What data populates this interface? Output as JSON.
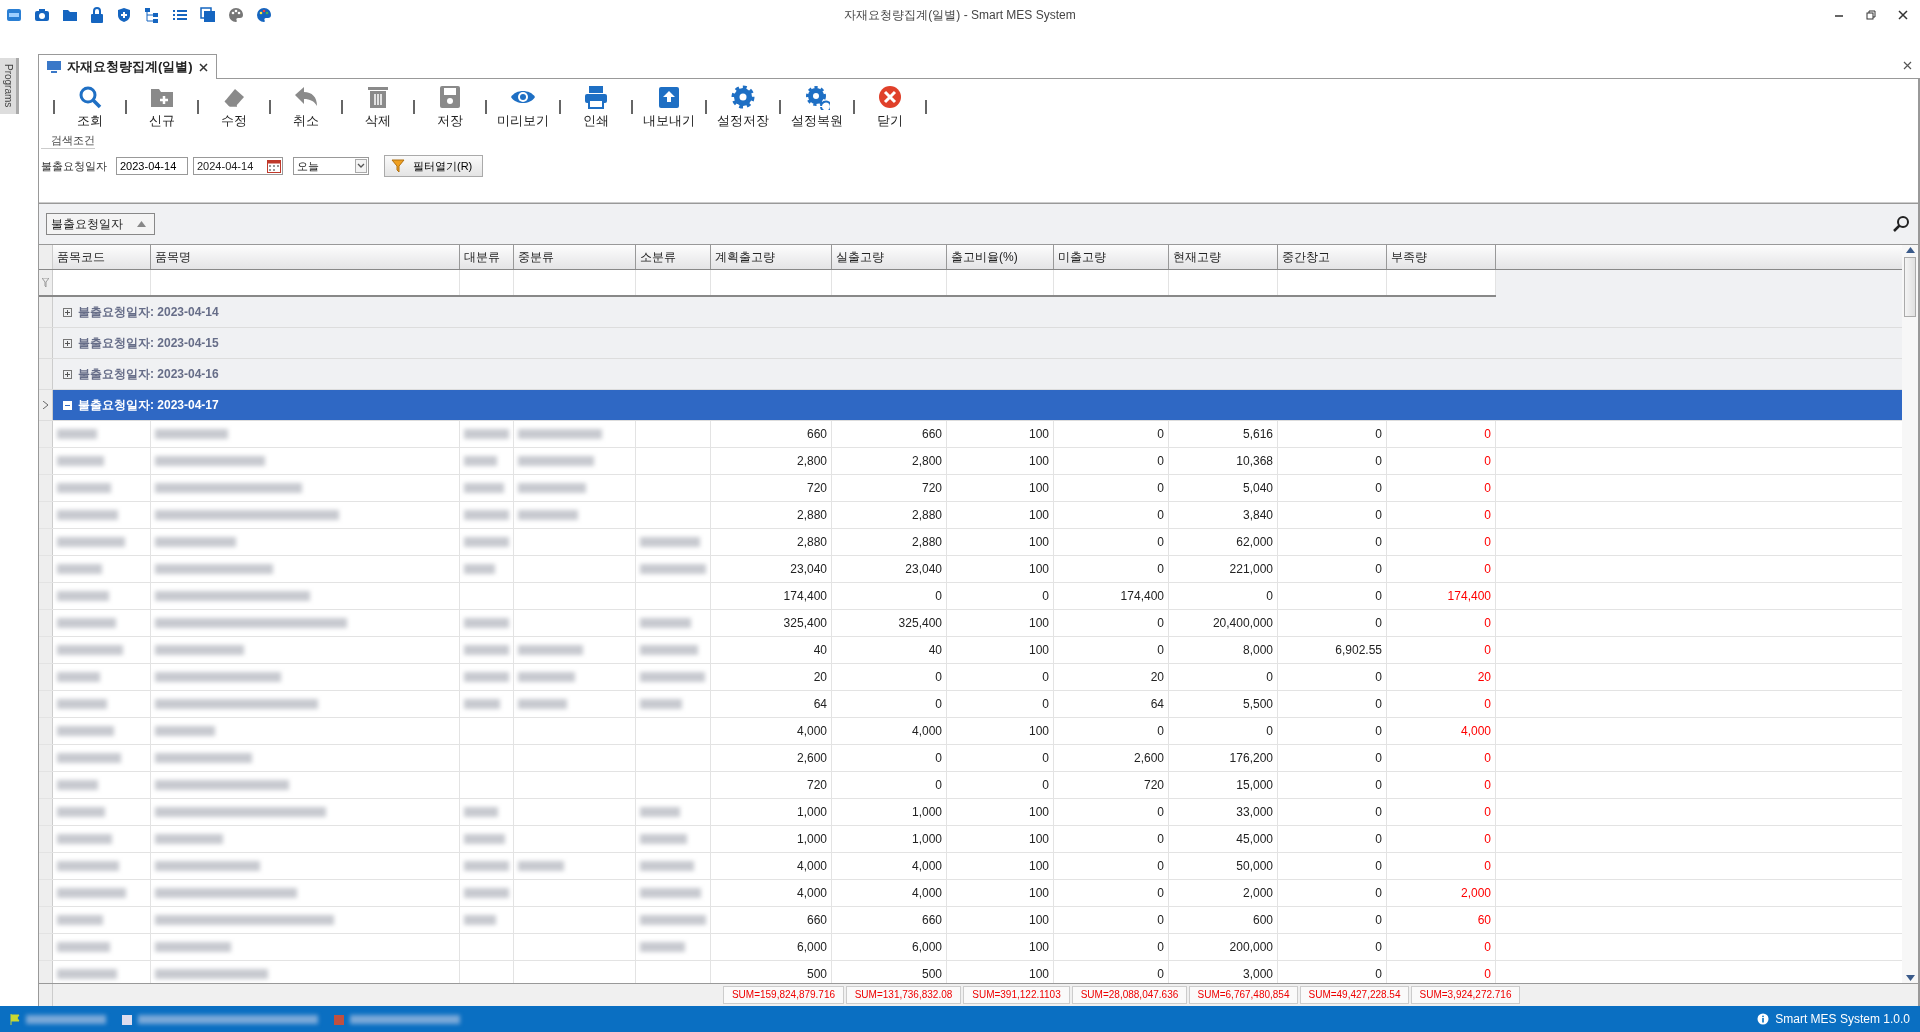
{
  "window": {
    "title": "자재요청량집계(일별) - Smart MES System"
  },
  "quick_icons": [
    {
      "kind": "app"
    },
    {
      "kind": "camera"
    },
    {
      "kind": "folder"
    },
    {
      "kind": "lock"
    },
    {
      "kind": "shield"
    },
    {
      "kind": "tree"
    },
    {
      "kind": "list"
    },
    {
      "kind": "windows"
    },
    {
      "kind": "palette"
    },
    {
      "kind": "palette-color"
    }
  ],
  "side_panel": {
    "label": "Programs"
  },
  "document_tab": {
    "label": "자재요청량집계(일별)",
    "selected": true
  },
  "toolbar": [
    {
      "label": "조회",
      "kind": "search"
    },
    {
      "label": "신규",
      "kind": "new"
    },
    {
      "label": "수정",
      "kind": "edit"
    },
    {
      "label": "취소",
      "kind": "undo"
    },
    {
      "label": "삭제",
      "kind": "delete"
    },
    {
      "label": "저장",
      "kind": "save"
    },
    {
      "label": "미리보기",
      "kind": "preview"
    },
    {
      "label": "인쇄",
      "kind": "print"
    },
    {
      "label": "내보내기",
      "kind": "export"
    },
    {
      "label": "설정저장",
      "kind": "settings-save"
    },
    {
      "label": "설정복원",
      "kind": "settings-restore"
    },
    {
      "label": "닫기",
      "kind": "close"
    }
  ],
  "search": {
    "group_title": "검색조건",
    "label": "불출요청일자",
    "date_from": "2023-04-14",
    "date_to": "2024-04-14",
    "period": "오늘",
    "filter_button": "필터열기(R)"
  },
  "grid": {
    "group_by": "불출요청일자",
    "columns": [
      {
        "label": "품목코드"
      },
      {
        "label": "품목명"
      },
      {
        "label": "대분류"
      },
      {
        "label": "중분류"
      },
      {
        "label": "소분류"
      },
      {
        "label": "계획출고량"
      },
      {
        "label": "실출고량"
      },
      {
        "label": "출고비율(%)"
      },
      {
        "label": "미출고량"
      },
      {
        "label": "현재고량"
      },
      {
        "label": "중간창고"
      },
      {
        "label": "부족량"
      }
    ],
    "groups": [
      {
        "label": "불출요청일자: 2023-04-14",
        "expanded": false,
        "selected": false
      },
      {
        "label": "불출요청일자: 2023-04-15",
        "expanded": false,
        "selected": false
      },
      {
        "label": "불출요청일자: 2023-04-16",
        "expanded": false,
        "selected": false
      },
      {
        "label": "불출요청일자: 2023-04-17",
        "expanded": true,
        "selected": true
      }
    ],
    "rows": [
      {
        "masked": [
          true,
          true,
          true,
          true,
          false
        ],
        "values": [
          "660",
          "660",
          "100",
          "0",
          "5,616",
          "0",
          "0"
        ]
      },
      {
        "masked": [
          true,
          true,
          true,
          true,
          false
        ],
        "values": [
          "2,800",
          "2,800",
          "100",
          "0",
          "10,368",
          "0",
          "0"
        ]
      },
      {
        "masked": [
          true,
          true,
          true,
          true,
          false
        ],
        "values": [
          "720",
          "720",
          "100",
          "0",
          "5,040",
          "0",
          "0"
        ]
      },
      {
        "masked": [
          true,
          true,
          true,
          true,
          false
        ],
        "values": [
          "2,880",
          "2,880",
          "100",
          "0",
          "3,840",
          "0",
          "0"
        ]
      },
      {
        "masked": [
          true,
          true,
          true,
          false,
          true
        ],
        "values": [
          "2,880",
          "2,880",
          "100",
          "0",
          "62,000",
          "0",
          "0"
        ]
      },
      {
        "masked": [
          true,
          true,
          true,
          false,
          true
        ],
        "values": [
          "23,040",
          "23,040",
          "100",
          "0",
          "221,000",
          "0",
          "0"
        ]
      },
      {
        "masked": [
          true,
          true,
          false,
          false,
          false
        ],
        "values": [
          "174,400",
          "0",
          "0",
          "174,400",
          "0",
          "0",
          "174,400"
        ]
      },
      {
        "masked": [
          true,
          true,
          true,
          false,
          true
        ],
        "values": [
          "325,400",
          "325,400",
          "100",
          "0",
          "20,400,000",
          "0",
          "0"
        ]
      },
      {
        "masked": [
          true,
          true,
          true,
          true,
          true
        ],
        "values": [
          "40",
          "40",
          "100",
          "0",
          "8,000",
          "6,902.55",
          "0"
        ]
      },
      {
        "masked": [
          true,
          true,
          true,
          true,
          true
        ],
        "values": [
          "20",
          "0",
          "0",
          "20",
          "0",
          "0",
          "20"
        ]
      },
      {
        "masked": [
          true,
          true,
          true,
          true,
          true
        ],
        "values": [
          "64",
          "0",
          "0",
          "64",
          "5,500",
          "0",
          "0"
        ]
      },
      {
        "masked": [
          true,
          true,
          false,
          false,
          false
        ],
        "values": [
          "4,000",
          "4,000",
          "100",
          "0",
          "0",
          "0",
          "4,000"
        ]
      },
      {
        "masked": [
          true,
          true,
          false,
          false,
          false
        ],
        "values": [
          "2,600",
          "0",
          "0",
          "2,600",
          "176,200",
          "0",
          "0"
        ]
      },
      {
        "masked": [
          true,
          true,
          false,
          false,
          false
        ],
        "values": [
          "720",
          "0",
          "0",
          "720",
          "15,000",
          "0",
          "0"
        ]
      },
      {
        "masked": [
          true,
          true,
          true,
          false,
          true
        ],
        "values": [
          "1,000",
          "1,000",
          "100",
          "0",
          "33,000",
          "0",
          "0"
        ]
      },
      {
        "masked": [
          true,
          true,
          true,
          false,
          true
        ],
        "values": [
          "1,000",
          "1,000",
          "100",
          "0",
          "45,000",
          "0",
          "0"
        ]
      },
      {
        "masked": [
          true,
          true,
          true,
          true,
          true
        ],
        "values": [
          "4,000",
          "4,000",
          "100",
          "0",
          "50,000",
          "0",
          "0"
        ]
      },
      {
        "masked": [
          true,
          true,
          true,
          false,
          true
        ],
        "values": [
          "4,000",
          "4,000",
          "100",
          "0",
          "2,000",
          "0",
          "2,000"
        ]
      },
      {
        "masked": [
          true,
          true,
          true,
          false,
          true
        ],
        "values": [
          "660",
          "660",
          "100",
          "0",
          "600",
          "0",
          "60"
        ]
      },
      {
        "masked": [
          true,
          true,
          false,
          false,
          true
        ],
        "values": [
          "6,000",
          "6,000",
          "100",
          "0",
          "200,000",
          "0",
          "0"
        ]
      },
      {
        "masked": [
          true,
          true,
          false,
          false,
          false
        ],
        "values": [
          "500",
          "500",
          "100",
          "0",
          "3,000",
          "0",
          "0"
        ]
      }
    ],
    "sums": [
      "SUM=159,824,879.716",
      "SUM=131,736,832.08",
      "SUM=391,122.1103",
      "SUM=28,088,047.636",
      "SUM=6,767,480,854",
      "SUM=49,427,228.54",
      "SUM=3,924,272.716"
    ]
  },
  "status_bar": {
    "masked_items": [
      {
        "kind": "flag"
      },
      {
        "kind": "square"
      },
      {
        "kind": "square-red"
      }
    ],
    "version": "Smart MES System 1.0.0"
  }
}
